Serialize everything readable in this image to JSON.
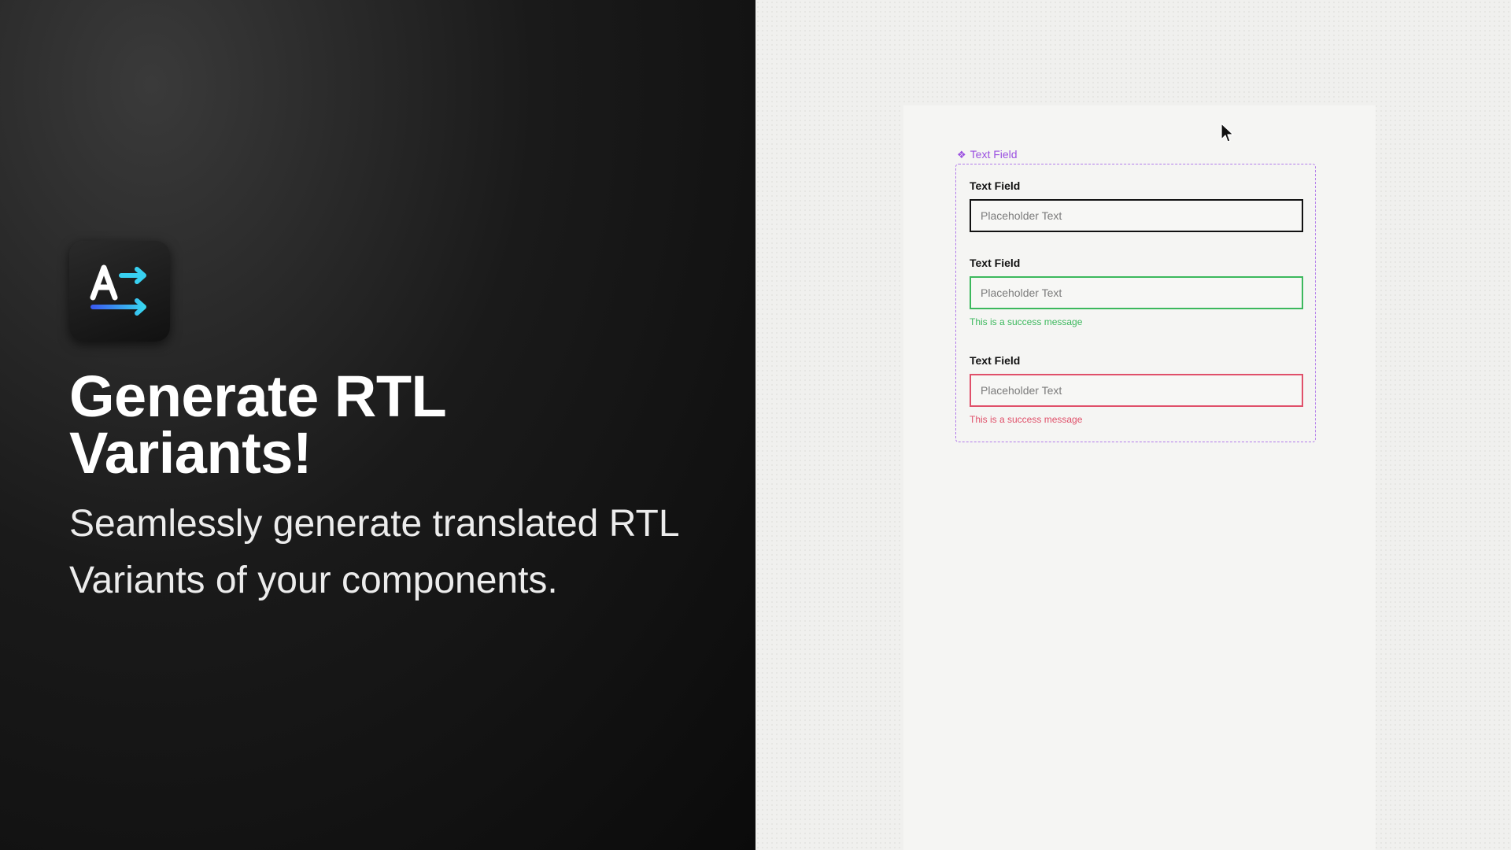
{
  "promo": {
    "app_icon": "translate-rtl-icon",
    "headline": "Generate RTL Variants!",
    "subline": "Seamlessly generate translated RTL Variants of your components."
  },
  "canvas": {
    "component_tag": {
      "icon": "component-diamond-icon",
      "label": "Text Field"
    },
    "fields": [
      {
        "label": "Text Field",
        "placeholder": "Placeholder Text",
        "state": "default"
      },
      {
        "label": "Text Field",
        "placeholder": "Placeholder Text",
        "state": "success",
        "helper": "This is a success message"
      },
      {
        "label": "Text Field",
        "placeholder": "Placeholder Text",
        "state": "error",
        "helper": "This is a success message"
      }
    ]
  },
  "colors": {
    "component_outline": "#b27bea",
    "component_tag": "#9b51e0",
    "success": "#3cb85d",
    "error": "#e0506a",
    "default_border": "#111111",
    "icon_arrow": "#38d0f0"
  }
}
